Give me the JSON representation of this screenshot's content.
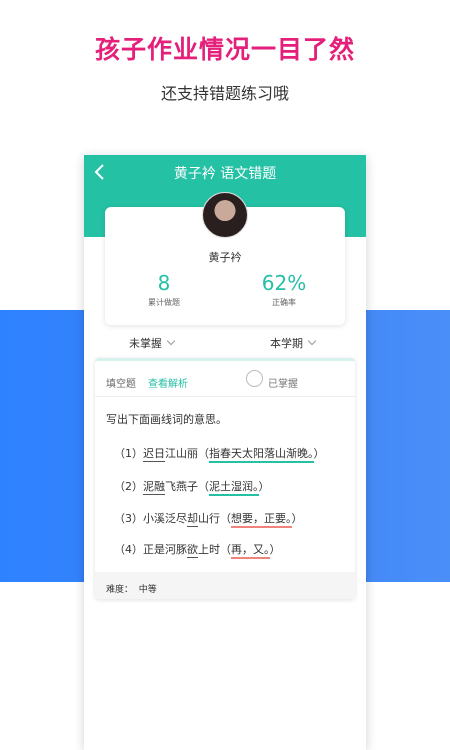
{
  "promo": {
    "headline": "孩子作业情况一目了然",
    "subline": "还支持错题练习哦"
  },
  "header": {
    "title": "黄子衿 语文错题"
  },
  "profile": {
    "name": "黄子衿",
    "stats": [
      {
        "value": "8",
        "label": "累计做题"
      },
      {
        "value": "62%",
        "label": "正确率"
      }
    ]
  },
  "filters": {
    "mastery": "未掌握",
    "term": "本学期"
  },
  "question": {
    "type": "填空题",
    "analysis_link": "查看解析",
    "mastered_label": "已掌握",
    "prompt": "写出下面画线词的意思。",
    "items": [
      {
        "num": "（1）",
        "pre": "",
        "underline": "迟日",
        "post": "江山丽（",
        "answer": "指春天太阳落山渐晚。",
        "close": "）"
      },
      {
        "num": "（2）",
        "pre": "",
        "underline": "泥融",
        "post": "飞燕子（",
        "answer": "泥土湿润。",
        "close": "）"
      },
      {
        "num": "（3）",
        "pre": "小溪泛尽",
        "underline": "却",
        "post": "山行（",
        "answer": "想要，正要。",
        "close": "）"
      },
      {
        "num": "（4）",
        "pre": "正是河豚",
        "underline": "欲",
        "post": "上时（",
        "answer": "再，又。",
        "close": "）"
      }
    ],
    "difficulty_label": "难度：",
    "difficulty_value": "中等"
  },
  "colors": {
    "accent": "#25c1a5",
    "headline": "#e5207a",
    "band": "#3b82f6",
    "wrong_underline": "#f0847c"
  },
  "icons": {
    "back": "chevron-left-icon",
    "dropdown": "chevron-down-icon",
    "radio": "radio-unchecked-icon"
  }
}
